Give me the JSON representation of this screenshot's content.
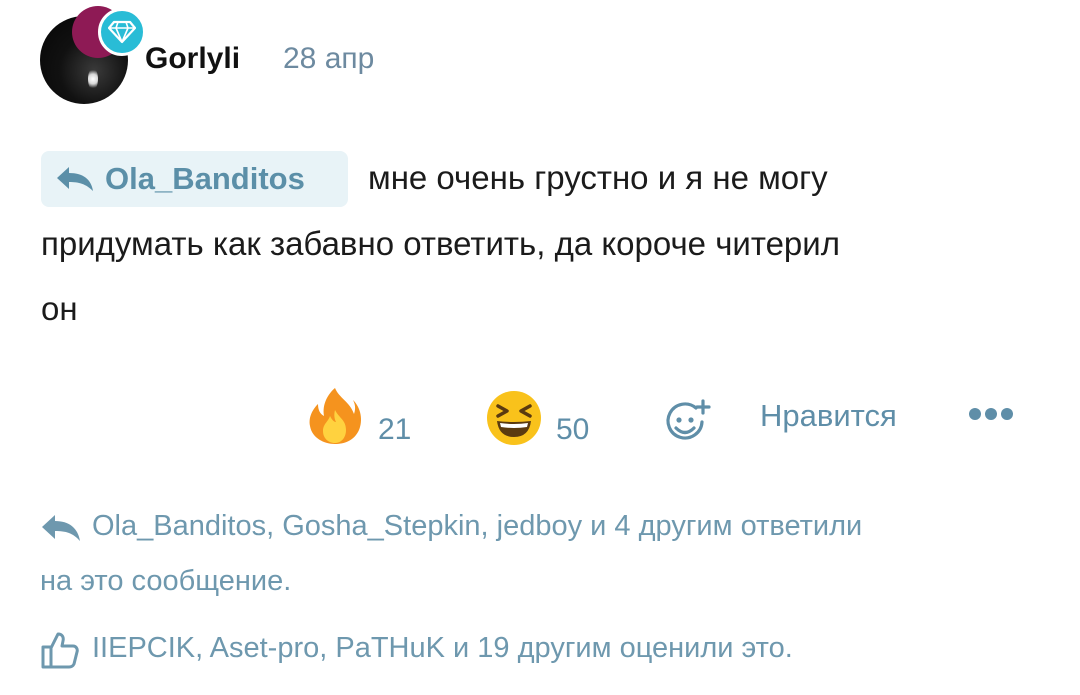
{
  "post": {
    "username": "Gorlyli",
    "date": "28 апр",
    "reply_to": "Ola_Banditos",
    "message_line1": "мне очень грустно и я не могу",
    "message_line2": "придумать как забавно ответить, да короче читерил",
    "message_line3": "он"
  },
  "reactions": [
    {
      "icon": "fire-emoji-icon",
      "count": "21"
    },
    {
      "icon": "laughing-emoji-icon",
      "count": "50"
    }
  ],
  "actions": {
    "like_label": "Нравится",
    "add_reaction_icon": "add-reaction-icon",
    "more_icon": "more-dots-icon"
  },
  "footer": {
    "replies_line1": "Ola_Banditos, Gosha_Stepkin, jedboy и 4 другим ответили",
    "replies_line2": "на это сообщение.",
    "likes_line": "IIEPCIK, Aset-pro, PaTHuK и 19 другим оценили это."
  },
  "colors": {
    "accent": "#5f8ea8",
    "reply_chip_bg": "#e8f3f7",
    "badge_blue": "#29bcd6",
    "badge_red": "#8e1a55"
  }
}
